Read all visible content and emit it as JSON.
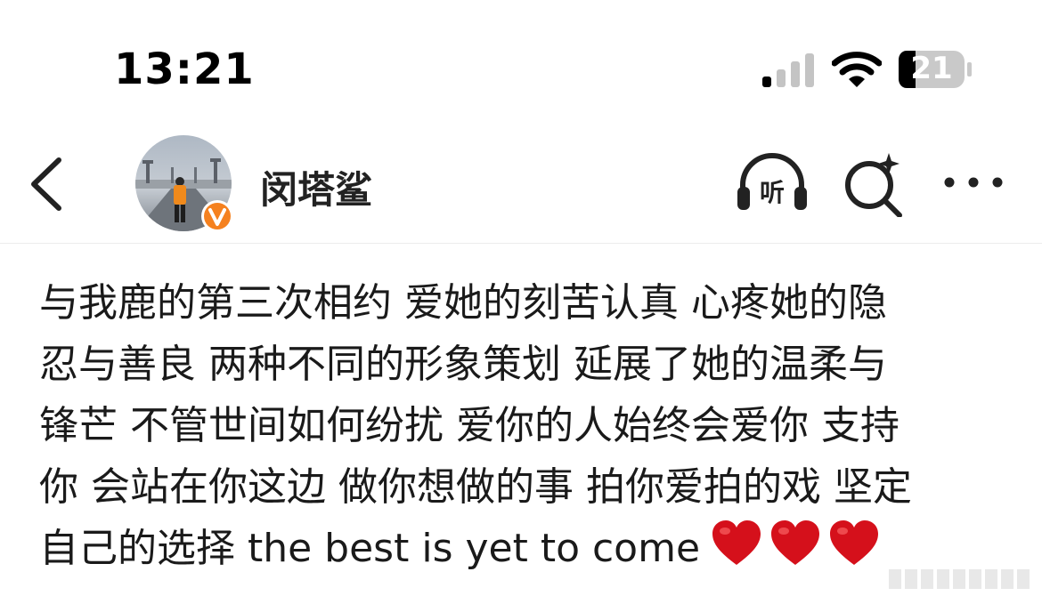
{
  "status_bar": {
    "time": "13:21",
    "battery": "21",
    "icons": [
      "signal-icon",
      "wifi-icon",
      "battery-icon"
    ]
  },
  "nav": {
    "back_icon": "chevron-left-icon",
    "username": "闵塔鲨",
    "verified": true,
    "listen_glyph": "听",
    "icons": [
      "listen-icon",
      "search-icon",
      "more-icon"
    ]
  },
  "post": {
    "lines": [
      "与我鹿的第三次相约 爱她的刻苦认真 心疼她的隐",
      "忍与善良 两种不同的形象策划 延展了她的温柔与",
      "锋芒 不管世间如何纷扰 爱你的人始终会爱你 支持",
      "你 会站在你这边 做你想做的事 拍你爱拍的戏 坚定",
      "自己的选择 the best is yet to come"
    ],
    "emoji": [
      "red-heart",
      "red-heart",
      "red-heart"
    ]
  },
  "colors": {
    "accent_orange": "#f5811f",
    "heart_red": "#d5101b",
    "text": "#1a1a1a",
    "divider": "#ececec"
  }
}
